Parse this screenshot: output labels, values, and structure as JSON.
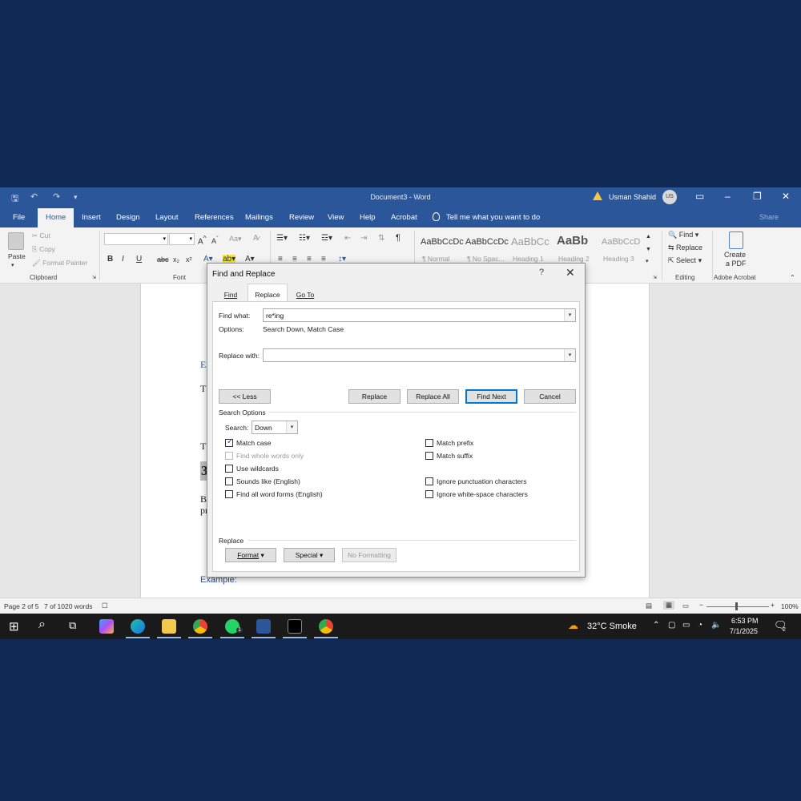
{
  "titlebar": {
    "title": "Document3 - Word",
    "user_name": "Usman Shahid",
    "user_initials": "US"
  },
  "ribbon_tabs": [
    "File",
    "Home",
    "Insert",
    "Design",
    "Layout",
    "References",
    "Mailings",
    "Review",
    "View",
    "Help",
    "Acrobat"
  ],
  "tell_me": "Tell me what you want to do",
  "share": "Share",
  "clipboard": {
    "paste": "Paste",
    "cut": "Cut",
    "copy": "Copy",
    "format_painter": "Format Painter",
    "label": "Clipboard"
  },
  "font_group": {
    "label": "Font",
    "bold": "B",
    "italic": "I",
    "underline": "U",
    "strike": "abc",
    "subscript": "x₂",
    "superscript": "x²"
  },
  "styles": [
    {
      "preview": "AaBbCcDc",
      "name": "¶ Normal"
    },
    {
      "preview": "AaBbCcDc",
      "name": "¶ No Spac..."
    },
    {
      "preview": "AaBbCc",
      "name": "Heading 1"
    },
    {
      "preview": "AaBb",
      "name": "Heading 2"
    },
    {
      "preview": "AaBbCcD",
      "name": "Heading 3"
    }
  ],
  "editing": {
    "find": "Find",
    "replace": "Replace",
    "select": "Select",
    "label": "Editing"
  },
  "acrobat": {
    "create": "Create",
    "pdf": "a PDF",
    "label": "Adobe Acrobat"
  },
  "document": {
    "line_ex": "Ex",
    "line_t": "T",
    "line_th": "Th",
    "line_3": "3",
    "line_b": "B",
    "line_pr": "pr",
    "example": "Example:"
  },
  "statusbar": {
    "page": "Page 2 of 5",
    "words": "7 of 1020 words",
    "zoom": "100%"
  },
  "taskbar": {
    "weather": "32°C  Smoke",
    "time": "6:53 PM",
    "date": "7/1/2025",
    "notif_count": "2",
    "whatsapp_badge": "1"
  },
  "dialog": {
    "title": "Find and Replace",
    "help": "?",
    "tabs": [
      "Find",
      "Replace",
      "Go To"
    ],
    "active_tab": "Replace",
    "find_what_label": "Find what:",
    "find_what_value": "re*ing",
    "options_label": "Options:",
    "options_value": "Search Down, Match Case",
    "replace_with_label": "Replace with:",
    "replace_with_value": "",
    "less_button": "<< Less",
    "replace_button": "Replace",
    "replace_all_button": "Replace All",
    "find_next_button": "Find Next",
    "cancel_button": "Cancel",
    "search_options_label": "Search Options",
    "search_label": "Search:",
    "search_value": "Down",
    "left_options": [
      {
        "label": "Match case",
        "checked": true,
        "enabled": true
      },
      {
        "label": "Find whole words only",
        "checked": false,
        "enabled": false
      },
      {
        "label": "Use wildcards",
        "checked": false,
        "enabled": true
      },
      {
        "label": "Sounds like (English)",
        "checked": false,
        "enabled": true
      },
      {
        "label": "Find all word forms (English)",
        "checked": false,
        "enabled": true
      }
    ],
    "right_options": [
      {
        "label": "Match prefix",
        "checked": false,
        "enabled": true
      },
      {
        "label": "Match suffix",
        "checked": false,
        "enabled": true
      },
      {
        "label": "Ignore punctuation characters",
        "checked": false,
        "enabled": true
      },
      {
        "label": "Ignore white-space characters",
        "checked": false,
        "enabled": true
      }
    ],
    "replace_section_label": "Replace",
    "format_button": "Format",
    "special_button": "Special",
    "no_formatting_button": "No Formatting"
  }
}
